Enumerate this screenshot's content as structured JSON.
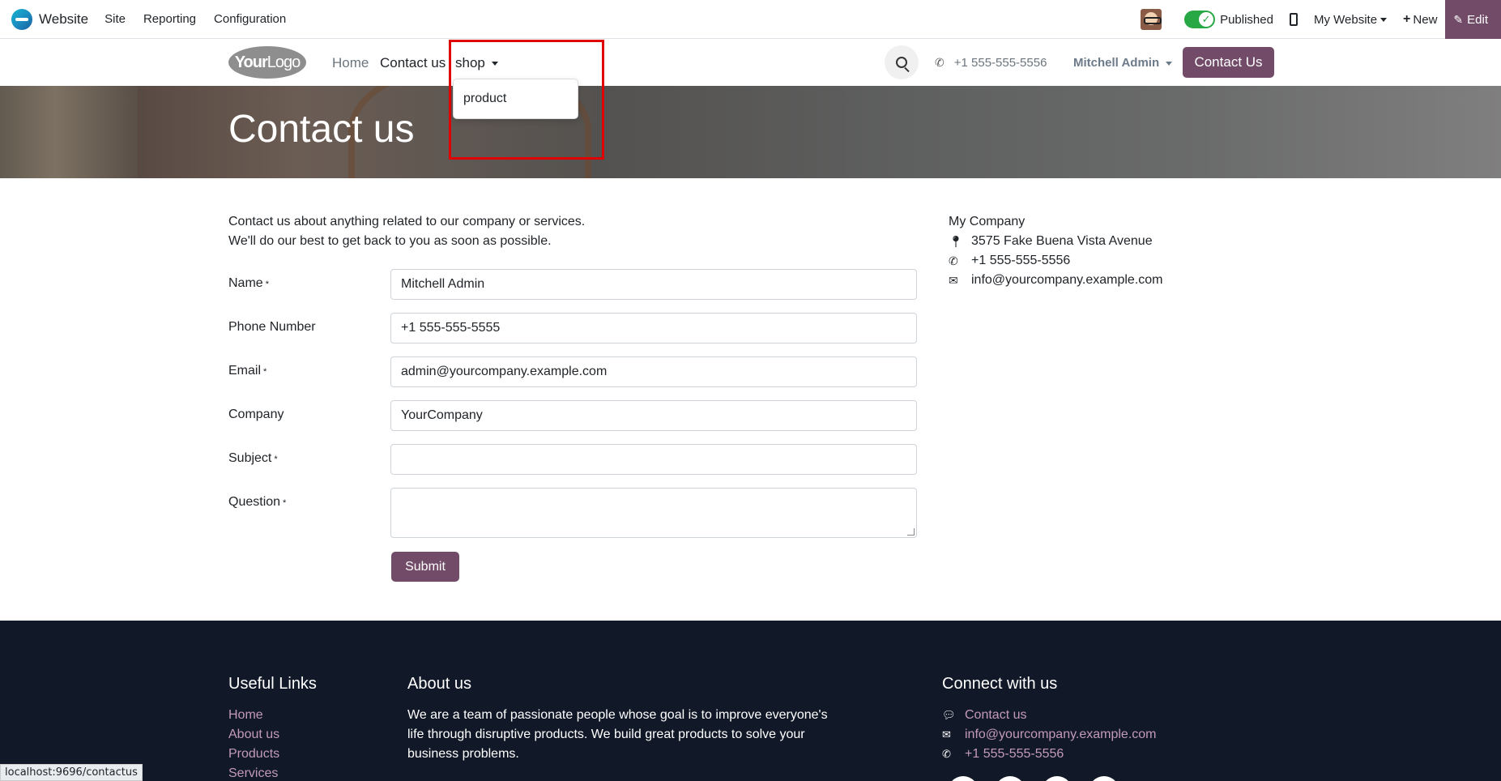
{
  "admin_bar": {
    "app_name": "Website",
    "menu": [
      "Site",
      "Reporting",
      "Configuration"
    ],
    "published_label": "Published",
    "website_label": "My Website",
    "new_label": "New",
    "edit_label": "Edit"
  },
  "header": {
    "logo_bold": "Your",
    "logo_text": "Logo",
    "nav": [
      "Home",
      "Contact us",
      "shop"
    ],
    "phone": "+1 555-555-5556",
    "user": "Mitchell Admin",
    "cta_label": "Contact Us"
  },
  "shop_dropdown": {
    "items": [
      "product"
    ]
  },
  "banner": {
    "title": "Contact us"
  },
  "intro": {
    "line1": "Contact us about anything related to our company or services.",
    "line2": "We'll do our best to get back to you as soon as possible."
  },
  "form": {
    "fields": [
      {
        "label": "Name",
        "required": "*",
        "value": "Mitchell Admin"
      },
      {
        "label": "Phone Number",
        "required": "",
        "value": "+1 555-555-5555"
      },
      {
        "label": "Email",
        "required": "*",
        "value": "admin@yourcompany.example.com"
      },
      {
        "label": "Company",
        "required": "",
        "value": "YourCompany"
      },
      {
        "label": "Subject",
        "required": "*",
        "value": ""
      },
      {
        "label": "Question",
        "required": "*",
        "value": ""
      }
    ],
    "submit_label": "Submit"
  },
  "company_info": {
    "name": "My Company",
    "address": "3575 Fake Buena Vista Avenue",
    "phone": "+1 555-555-5556",
    "email": "info@yourcompany.example.com"
  },
  "footer": {
    "useful_links_title": "Useful Links",
    "useful_links": [
      "Home",
      "About us",
      "Products",
      "Services"
    ],
    "about_title": "About us",
    "about_text": "We are a team of passionate people whose goal is to improve everyone's life through disruptive products. We build great products to solve your business problems.",
    "connect_title": "Connect with us",
    "connect": {
      "contact": "Contact us",
      "email": "info@yourcompany.example.com",
      "phone": "+1 555-555-5556"
    }
  },
  "status_bar": {
    "url": "localhost:9696/contactus"
  },
  "colors": {
    "brand": "#714b67",
    "footer_bg": "#111827",
    "footer_link": "#c39ab9",
    "highlight": "#e00000"
  }
}
